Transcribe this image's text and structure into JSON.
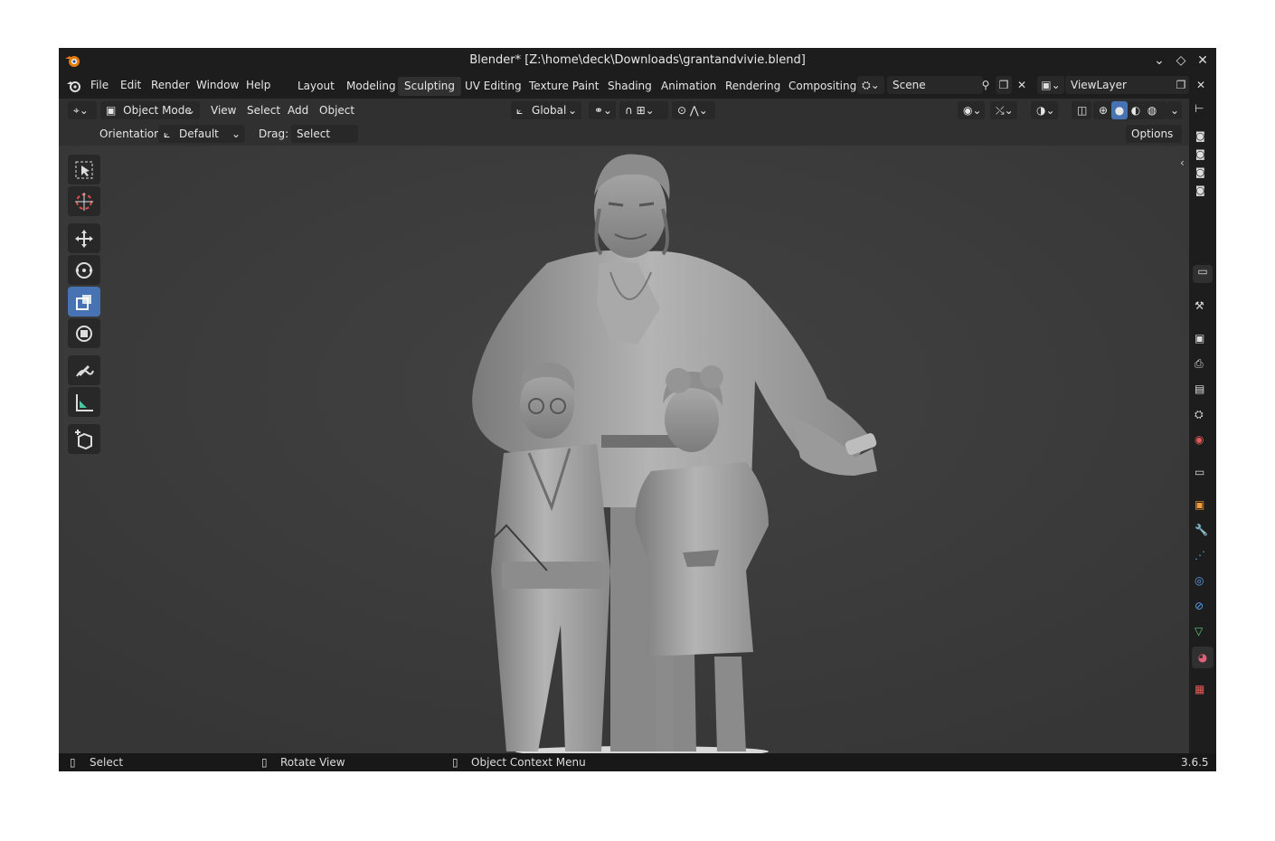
{
  "window": {
    "title": "Blender* [Z:\\home\\deck\\Downloads\\grantandvivie.blend]"
  },
  "menu": {
    "items": [
      "File",
      "Edit",
      "Render",
      "Window",
      "Help"
    ]
  },
  "workspaces": {
    "tabs": [
      "Layout",
      "Modeling",
      "Sculpting",
      "UV Editing",
      "Texture Paint",
      "Shading",
      "Animation",
      "Rendering",
      "Compositing"
    ],
    "active": "Sculpting"
  },
  "scene": {
    "value": "Scene"
  },
  "viewlayer": {
    "value": "ViewLayer"
  },
  "header": {
    "mode": "Object Mode",
    "menus": [
      "View",
      "Select",
      "Add",
      "Object"
    ],
    "transform_orientation": "Global",
    "options_label": "Options"
  },
  "tool_settings": {
    "orientation_label": "Orientation:",
    "orientation_value": "Default",
    "drag_label": "Drag:",
    "drag_value": "Select Box"
  },
  "status": {
    "left": "Select",
    "middle": "Rotate View",
    "right": "Object Context Menu",
    "version": "3.6.5"
  },
  "colors": {
    "accent": "#4772b3",
    "viewport_bg": "#3c3c3c",
    "panel_bg": "#1d1d1d"
  },
  "icons": {
    "tools": [
      "select-box-icon",
      "cursor-icon",
      "move-icon",
      "rotate-icon",
      "scale-icon",
      "transform-icon",
      "annotate-icon",
      "measure-icon",
      "add-cube-icon"
    ],
    "properties": [
      "tool-icon",
      "render-icon",
      "output-icon",
      "view-layer-icon",
      "scene-icon",
      "world-icon",
      "collection-icon",
      "object-icon",
      "modifier-icon",
      "particles-icon",
      "physics-icon",
      "constraints-icon",
      "data-icon",
      "material-icon",
      "texture-icon"
    ]
  }
}
